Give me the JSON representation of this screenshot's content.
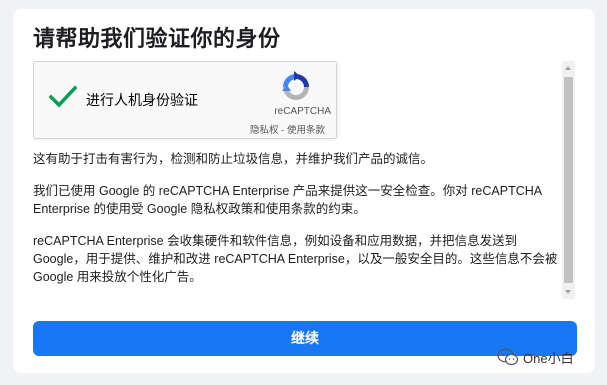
{
  "dialog": {
    "title": "请帮助我们验证你的身份"
  },
  "recaptcha": {
    "label": "进行人机身份验证",
    "checked": true,
    "brand": "reCAPTCHA",
    "privacy_link": "隐私权",
    "separator": " - ",
    "terms_link": "使用条款",
    "icons": [
      "check-icon",
      "recaptcha-logo-icon"
    ],
    "colors": {
      "check": "#009e55",
      "logo_blue": "#1c3aa9",
      "logo_light": "#4285f4",
      "logo_gray": "#b5b5b5"
    }
  },
  "content": {
    "paragraph1": "这有助于打击有害行为，检测和防止垃圾信息，并维护我们产品的诚信。",
    "paragraph2": "我们已使用 Google 的 reCAPTCHA Enterprise 产品来提供这一安全检查。你对 reCAPTCHA Enterprise 的使用受 Google 隐私权政策和使用条款的约束。",
    "paragraph3": "reCAPTCHA Enterprise 会收集硬件和软件信息，例如设备和应用数据，并把信息发送到 Google，用于提供、维护和改进 reCAPTCHA Enterprise，以及一般安全目的。这些信息不会被 Google 用来投放个性化广告。"
  },
  "actions": {
    "continue_label": "继续",
    "accent_color": "#1877f2"
  },
  "watermark": {
    "text": "One小白",
    "icon": "wechat-icon"
  }
}
